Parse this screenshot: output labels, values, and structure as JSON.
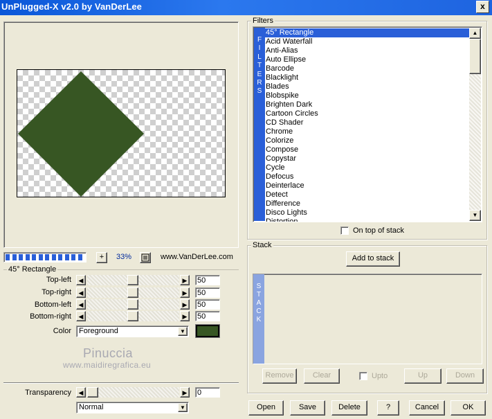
{
  "window": {
    "title": "UnPlugged-X v2.0 by VanDerLee",
    "close_label": "x"
  },
  "preview": {
    "zoom": "33%",
    "zoom_minus": "+",
    "url": "www.VanDerLee.com",
    "progress_segments": 12,
    "shape_color": "#375623"
  },
  "params": {
    "group_title": "45° Rectangle",
    "sliders": [
      {
        "label": "Top-left",
        "value": "50"
      },
      {
        "label": "Top-right",
        "value": "50"
      },
      {
        "label": "Bottom-left",
        "value": "50"
      },
      {
        "label": "Bottom-right",
        "value": "50"
      }
    ],
    "color_label": "Color",
    "color_value": "Foreground",
    "color_swatch": "#375623",
    "transparency_label": "Transparency",
    "transparency_value": "0",
    "blend_mode": "Normal"
  },
  "watermark": {
    "line1": "Pinuccia",
    "line2": "www.maidiregrafica.eu"
  },
  "filters": {
    "group_title": "Filters",
    "band_letters": [
      "F",
      "I",
      "L",
      "T",
      "E",
      "R",
      "S"
    ],
    "items": [
      "45° Rectangle",
      "Acid Waterfall",
      "Anti-Alias",
      "Auto Ellipse",
      "Barcode",
      "Blacklight",
      "Blades",
      "Blobspike",
      "Brighten Dark",
      "Cartoon Circles",
      "CD Shader",
      "Chrome",
      "Colorize",
      "Compose",
      "Copystar",
      "Cycle",
      "Defocus",
      "Deinterlace",
      "Detect",
      "Difference",
      "Disco Lights",
      "Distortion"
    ],
    "selected_index": 0,
    "on_top_label": "On top of stack"
  },
  "stack": {
    "group_title": "Stack",
    "add_label": "Add to stack",
    "band_letters": [
      "S",
      "T",
      "A",
      "C",
      "K"
    ],
    "remove_label": "Remove",
    "clear_label": "Clear",
    "upto_label": "Upto",
    "up_label": "Up",
    "down_label": "Down"
  },
  "footer": {
    "open_label": "Open",
    "save_label": "Save",
    "delete_label": "Delete",
    "help_label": "?",
    "cancel_label": "Cancel",
    "ok_label": "OK"
  }
}
